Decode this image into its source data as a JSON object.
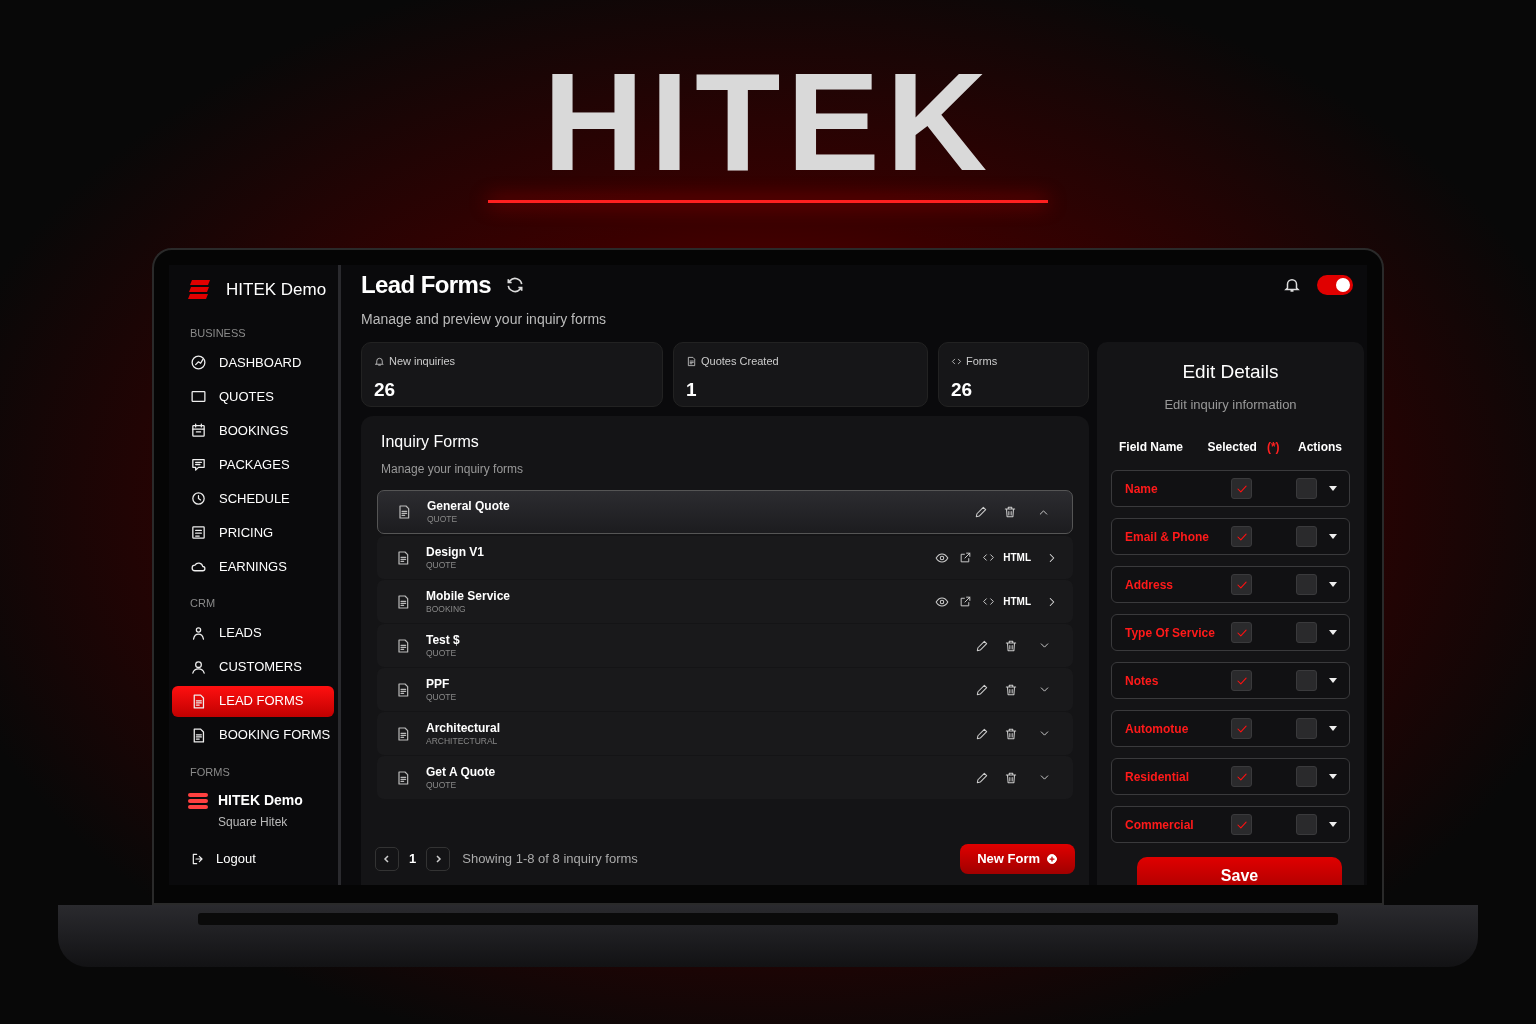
{
  "hero_title": "HITEK",
  "sidebar": {
    "brand": "HITEK Demo",
    "sections": [
      {
        "heading": "BUSINESS",
        "items": [
          {
            "label": "DASHBOARD",
            "selected": false
          },
          {
            "label": "QUOTES",
            "selected": false
          },
          {
            "label": "BOOKINGS",
            "selected": false
          },
          {
            "label": "PACKAGES",
            "selected": false
          },
          {
            "label": "SCHEDULE",
            "selected": false
          },
          {
            "label": "PRICING",
            "selected": false
          },
          {
            "label": "EARNINGS",
            "selected": false
          }
        ]
      },
      {
        "heading": "CRM",
        "items": [
          {
            "label": "LEADS",
            "selected": false
          },
          {
            "label": "CUSTOMERS",
            "selected": false
          },
          {
            "label": "LEAD FORMS",
            "selected": true
          },
          {
            "label": "BOOKING FORMS",
            "selected": false
          }
        ]
      },
      {
        "heading": "FORMS"
      }
    ],
    "account": {
      "name": "HITEK Demo",
      "subtitle": "Square Hitek"
    },
    "logout": "Logout"
  },
  "header": {
    "title": "Lead Forms",
    "subtitle": "Manage and preview your inquiry forms",
    "toggle": {
      "on": true
    }
  },
  "stats": [
    {
      "label": "New inquiries",
      "value": "26"
    },
    {
      "label": "Quotes Created",
      "value": "1"
    },
    {
      "label": "Forms",
      "value": "26"
    }
  ],
  "inquiry_forms": {
    "title": "Inquiry Forms",
    "subtitle": "Manage your inquiry forms",
    "rows": [
      {
        "name": "General Quote",
        "type": "QUOTE",
        "kind": "editable",
        "expanded": true
      },
      {
        "name": "Design V1",
        "type": "QUOTE",
        "kind": "html",
        "action_label": "HTML",
        "expanded": false
      },
      {
        "name": "Mobile Service",
        "type": "BOOKING",
        "kind": "html",
        "action_label": "HTML",
        "expanded": false
      },
      {
        "name": "Test $",
        "type": "QUOTE",
        "kind": "editable",
        "expanded": false
      },
      {
        "name": "PPF",
        "type": "QUOTE",
        "kind": "editable",
        "expanded": false
      },
      {
        "name": "Architectural",
        "type": "ARCHITECTURAL",
        "kind": "editable",
        "expanded": false
      },
      {
        "name": "Get A Quote",
        "type": "QUOTE",
        "kind": "editable",
        "expanded": false
      }
    ],
    "pagination": {
      "page": "1",
      "summary": "Showing 1-8 of 8 inquiry forms"
    },
    "new_button": "New Form"
  },
  "edit_details": {
    "title": "Edit Details",
    "subtitle": "Edit inquiry information",
    "columns": [
      {
        "label": "Field Name"
      },
      {
        "label": "Selected",
        "marker": "(*)"
      },
      {
        "label": "Actions"
      }
    ],
    "fields": [
      {
        "name": "Name",
        "selected": true,
        "checked": false
      },
      {
        "name": "Email & Phone",
        "selected": true,
        "checked": false
      },
      {
        "name": "Address",
        "selected": true,
        "checked": false
      },
      {
        "name": "Type Of Service",
        "selected": true,
        "checked": false
      },
      {
        "name": "Notes",
        "selected": true,
        "checked": false
      },
      {
        "name": "Automotue",
        "selected": true,
        "checked": false
      },
      {
        "name": "Residential",
        "selected": true,
        "checked": false
      },
      {
        "name": "Commercial",
        "selected": true,
        "checked": false
      }
    ],
    "save": "Save"
  }
}
